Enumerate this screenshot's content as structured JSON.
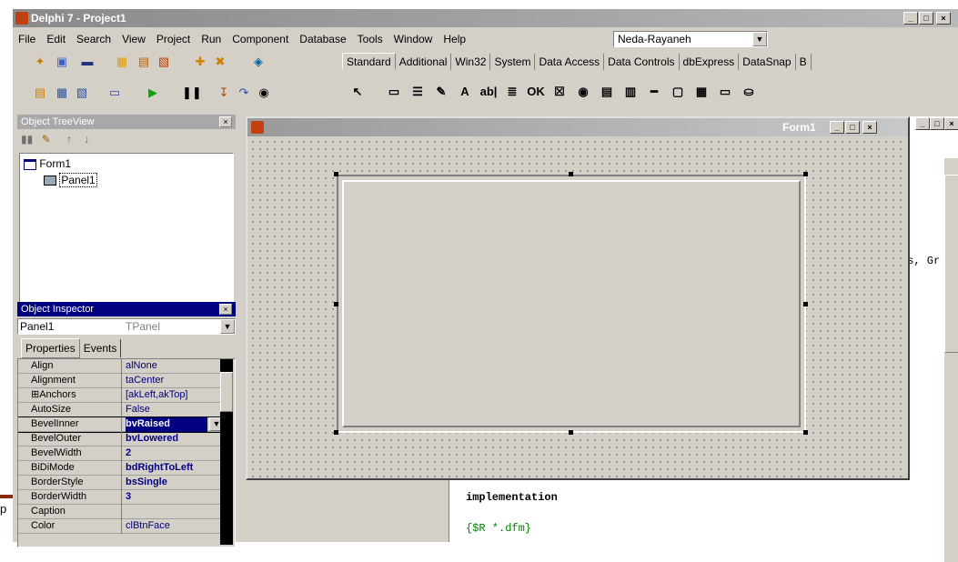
{
  "window": {
    "title": "Delphi 7 - Project1",
    "min": "_",
    "max": "□",
    "close": "×"
  },
  "menus": [
    "File",
    "Edit",
    "Search",
    "View",
    "Project",
    "Run",
    "Component",
    "Database",
    "Tools",
    "Window",
    "Help"
  ],
  "desktop_combo": {
    "value": "Neda-Rayaneh"
  },
  "palette_tabs": [
    "Standard",
    "Additional",
    "Win32",
    "System",
    "Data Access",
    "Data Controls",
    "dbExpress",
    "DataSnap",
    "B"
  ],
  "palette_icons": [
    "↖",
    "▭",
    "☰",
    "✎",
    "A",
    "ab|",
    "≣",
    "OK",
    "☒",
    "◉",
    "▤",
    "▥",
    "━",
    "▢",
    "▦",
    "▭",
    "⛀"
  ],
  "treeview": {
    "title": "Object TreeView",
    "items": [
      "Form1",
      "Panel1"
    ]
  },
  "inspector": {
    "title": "Object Inspector",
    "selected": {
      "name": "Panel1",
      "type": "TPanel"
    },
    "tabs": [
      "Properties",
      "Events"
    ],
    "rows": [
      {
        "name": "Align",
        "value": "alNone"
      },
      {
        "name": "Alignment",
        "value": "taCenter"
      },
      {
        "name": "⊞Anchors",
        "value": "[akLeft,akTop]"
      },
      {
        "name": "AutoSize",
        "value": "False"
      },
      {
        "name": "BevelInner",
        "value": "bvRaised"
      },
      {
        "name": "BevelOuter",
        "value": "bvLowered"
      },
      {
        "name": "BevelWidth",
        "value": "2"
      },
      {
        "name": "BiDiMode",
        "value": "bdRightToLeft"
      },
      {
        "name": "BorderStyle",
        "value": "bsSingle"
      },
      {
        "name": "BorderWidth",
        "value": "3"
      },
      {
        "name": "Caption",
        "value": ""
      },
      {
        "name": "Color",
        "value": "clBtnFace"
      }
    ]
  },
  "form": {
    "caption": "Form1"
  },
  "editor": {
    "snippet_right": "es, Gr",
    "lines": [
      "implementation",
      "{$R *.dfm}"
    ]
  },
  "left_edge_text": "p"
}
